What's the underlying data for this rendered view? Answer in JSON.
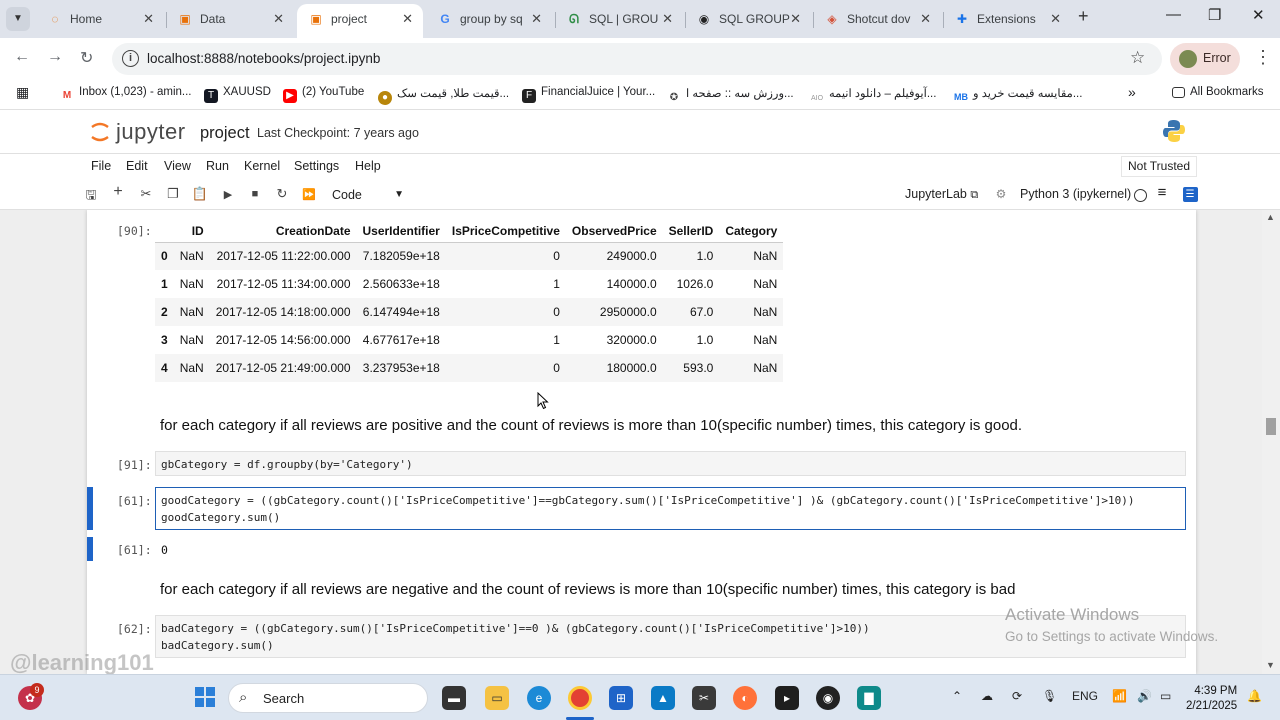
{
  "browser": {
    "tabs": [
      {
        "title": "Home",
        "icon": "loading-spinner-icon",
        "color": "#e8710a"
      },
      {
        "title": "Data",
        "icon": "jupyter-file-icon",
        "color": "#e8710a"
      },
      {
        "title": "project",
        "icon": "jupyter-file-icon",
        "color": "#e8710a"
      },
      {
        "title": "group by sq",
        "icon": "google-icon",
        "color": "#4285f4"
      },
      {
        "title": "SQL | GROU",
        "icon": "geeks-icon",
        "color": "#2f8d46"
      },
      {
        "title": "SQL GROUP",
        "icon": "w3-icon",
        "color": "#222222"
      },
      {
        "title": "Shotcut dov",
        "icon": "shotcut-icon",
        "color": "#d4533a"
      },
      {
        "title": "Extensions",
        "icon": "puzzle-icon",
        "color": "#1a73e8"
      }
    ],
    "url": "localhost:8888/notebooks/project.ipynb",
    "profile_label": "Error",
    "bookmarks": [
      {
        "label": "Inbox (1,023) - amin...",
        "icon": "gmail-icon",
        "color": "#ea4335"
      },
      {
        "label": "XAUUSD",
        "icon": "tradingview-icon",
        "color": "#131722"
      },
      {
        "label": "(2) YouTube",
        "icon": "youtube-icon",
        "color": "#ff0000"
      },
      {
        "label": "قیمت طلا, قیمت سک...",
        "icon": "coin-icon",
        "color": "#b8860b"
      },
      {
        "label": "FinancialJuice | Your...",
        "icon": "financialjuice-icon",
        "color": "#222222"
      },
      {
        "label": "ورزش سه :: صفحه ا...",
        "icon": "varzesh-icon",
        "color": "#444444"
      },
      {
        "label": "آیوفیلم – دانلود انیمه...",
        "icon": "aio-icon",
        "color": "#999999"
      },
      {
        "label": "مقایسه قیمت خرید و...",
        "icon": "mb-icon",
        "color": "#1a73e8"
      }
    ],
    "all_bookmarks": "All Bookmarks"
  },
  "jupyter": {
    "logo_text": "jupyter",
    "notebook_name": "project",
    "checkpoint": "Last Checkpoint: 7 years ago",
    "menu": [
      "File",
      "Edit",
      "View",
      "Run",
      "Kernel",
      "Settings",
      "Help"
    ],
    "trust": "Not Trusted",
    "celltype": "Code",
    "jupyterlab_label": "JupyterLab",
    "kernel": "Python 3 (ipykernel)"
  },
  "cells": {
    "out90_prompt": "[90]:",
    "df_columns": [
      "",
      "ID",
      "CreationDate",
      "UserIdentifier",
      "IsPriceCompetitive",
      "ObservedPrice",
      "SellerID",
      "Category"
    ],
    "df_rows": [
      [
        "0",
        "NaN",
        "2017-12-05 11:22:00.000",
        "7.182059e+18",
        "0",
        "249000.0",
        "1.0",
        "NaN"
      ],
      [
        "1",
        "NaN",
        "2017-12-05 11:34:00.000",
        "2.560633e+18",
        "1",
        "140000.0",
        "1026.0",
        "NaN"
      ],
      [
        "2",
        "NaN",
        "2017-12-05 14:18:00.000",
        "6.147494e+18",
        "0",
        "2950000.0",
        "67.0",
        "NaN"
      ],
      [
        "3",
        "NaN",
        "2017-12-05 14:56:00.000",
        "4.677617e+18",
        "1",
        "320000.0",
        "1.0",
        "NaN"
      ],
      [
        "4",
        "NaN",
        "2017-12-05 21:49:00.000",
        "3.237953e+18",
        "0",
        "180000.0",
        "593.0",
        "NaN"
      ]
    ],
    "md1": "for each category if all reviews are positive and the count of reviews is more than 10(specific number) times, this category is good.",
    "in91_prompt": "[91]:",
    "in91_code": "gbCategory = df.groupby(by='Category')",
    "in61_prompt": "[61]:",
    "in61_line1": "goodCategory = ((gbCategory.count()['IsPriceCompetitive']==gbCategory.sum()['IsPriceCompetitive'] )& (gbCategory.count()['IsPriceCompetitive']>10))",
    "in61_line2": "goodCategory.sum()",
    "out61_prompt": "[61]:",
    "out61_value": "0",
    "md2": "for each category if all reviews are negative and the count of reviews is more than 10(specific number) times, this category is bad",
    "in62_prompt": "[62]:",
    "in62_line1": "badCategory = ((gbCategory.sum()['IsPriceCompetitive']==0 )& (gbCategory.count()['IsPriceCompetitive']>10))",
    "in62_line2": "badCategory.sum()"
  },
  "overlay": {
    "activate_title": "Activate Windows",
    "activate_sub": "Go to Settings to activate Windows.",
    "channel": "@learning101"
  },
  "taskbar": {
    "search_placeholder": "Search",
    "badge": "9",
    "lang": "ENG",
    "time": "4:39 PM",
    "date": "2/21/2025"
  }
}
